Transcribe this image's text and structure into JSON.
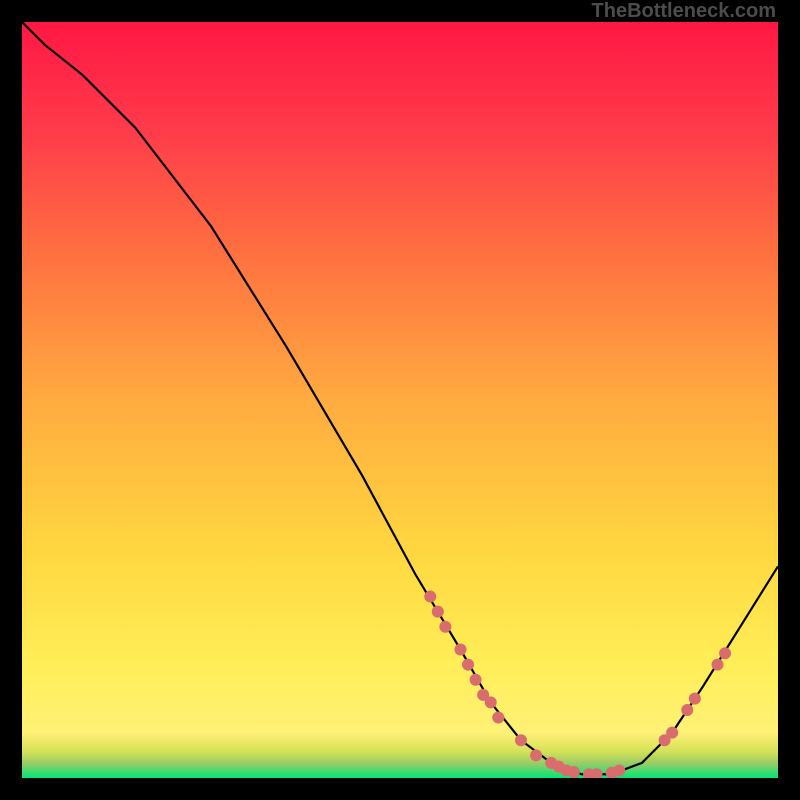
{
  "watermark": "TheBottleneck.com",
  "chart_data": {
    "type": "line",
    "title": "",
    "xlabel": "",
    "ylabel": "",
    "xlim": [
      0,
      100
    ],
    "ylim": [
      0,
      100
    ],
    "curve": [
      {
        "x": 0,
        "y": 100
      },
      {
        "x": 3,
        "y": 97
      },
      {
        "x": 8,
        "y": 93
      },
      {
        "x": 15,
        "y": 86
      },
      {
        "x": 25,
        "y": 73
      },
      {
        "x": 35,
        "y": 57
      },
      {
        "x": 45,
        "y": 40
      },
      {
        "x": 52,
        "y": 27
      },
      {
        "x": 58,
        "y": 17
      },
      {
        "x": 62,
        "y": 10
      },
      {
        "x": 66,
        "y": 5
      },
      {
        "x": 70,
        "y": 2
      },
      {
        "x": 74,
        "y": 0.5
      },
      {
        "x": 78,
        "y": 0.5
      },
      {
        "x": 82,
        "y": 2
      },
      {
        "x": 86,
        "y": 6
      },
      {
        "x": 90,
        "y": 12
      },
      {
        "x": 95,
        "y": 20
      },
      {
        "x": 100,
        "y": 28
      }
    ],
    "markers": [
      {
        "x": 54,
        "y": 24
      },
      {
        "x": 55,
        "y": 22
      },
      {
        "x": 56,
        "y": 20
      },
      {
        "x": 58,
        "y": 17
      },
      {
        "x": 59,
        "y": 15
      },
      {
        "x": 60,
        "y": 13
      },
      {
        "x": 61,
        "y": 11
      },
      {
        "x": 62,
        "y": 10
      },
      {
        "x": 63,
        "y": 8
      },
      {
        "x": 66,
        "y": 5
      },
      {
        "x": 68,
        "y": 3
      },
      {
        "x": 70,
        "y": 2
      },
      {
        "x": 71,
        "y": 1.5
      },
      {
        "x": 72,
        "y": 1
      },
      {
        "x": 73,
        "y": 0.8
      },
      {
        "x": 75,
        "y": 0.5
      },
      {
        "x": 76,
        "y": 0.5
      },
      {
        "x": 78,
        "y": 0.7
      },
      {
        "x": 79,
        "y": 1
      },
      {
        "x": 85,
        "y": 5
      },
      {
        "x": 86,
        "y": 6
      },
      {
        "x": 88,
        "y": 9
      },
      {
        "x": 89,
        "y": 10.5
      },
      {
        "x": 92,
        "y": 15
      },
      {
        "x": 93,
        "y": 16.5
      }
    ],
    "marker_color": "#d96c6c",
    "curve_color": "#000000",
    "green_band": {
      "y_from": 0,
      "y_to": 3,
      "color_bottom": "#00e676",
      "color_top": "#9acd32"
    },
    "gradient_stops": [
      {
        "offset": 0,
        "color": "#ff1744"
      },
      {
        "offset": 15,
        "color": "#ff3d4a"
      },
      {
        "offset": 30,
        "color": "#ff6e40"
      },
      {
        "offset": 50,
        "color": "#ffab40"
      },
      {
        "offset": 70,
        "color": "#ffd740"
      },
      {
        "offset": 85,
        "color": "#ffee58"
      },
      {
        "offset": 94,
        "color": "#fff176"
      },
      {
        "offset": 96.5,
        "color": "#d4e157"
      },
      {
        "offset": 98,
        "color": "#9ccc65"
      },
      {
        "offset": 100,
        "color": "#00e676"
      }
    ]
  }
}
